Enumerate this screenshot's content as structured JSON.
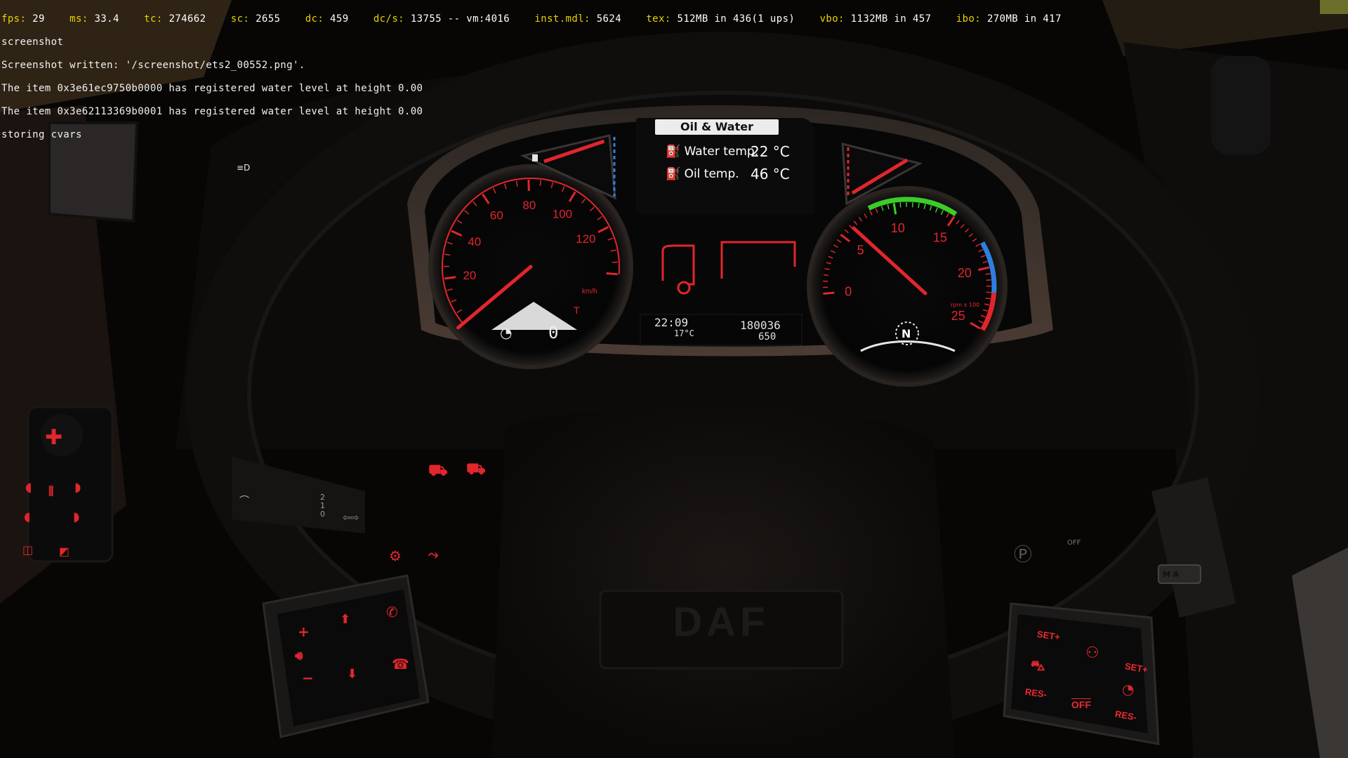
{
  "console": {
    "stats": [
      {
        "label": "fps:",
        "value": "29"
      },
      {
        "label": "ms:",
        "value": "33.4"
      },
      {
        "label": "tc:",
        "value": "274662"
      },
      {
        "label": "sc:",
        "value": "2655"
      },
      {
        "label": "dc:",
        "value": "459"
      },
      {
        "label": "dc/s:",
        "value": "13755 -- vm:4016"
      },
      {
        "label": "inst.mdl:",
        "value": "5624"
      },
      {
        "label": "tex:",
        "value": "512MB in 436(1 ups)"
      },
      {
        "label": "vbo:",
        "value": "1132MB in 457"
      },
      {
        "label": "ibo:",
        "value": "270MB in 417"
      }
    ],
    "lines": [
      "screenshot",
      "Screenshot written: '/screenshot/ets2_00552.png'.",
      "The item 0x3e61ec9750b0000 has registered water level at height 0.00",
      "The item 0x3e62113369b0001 has registered water level at height 0.00",
      "storing cvars"
    ]
  },
  "dashboard": {
    "lcd": {
      "tab_title": "Oil & Water",
      "water_label": "Water temp.",
      "water_value": "22 °C",
      "oil_label": "Oil temp.",
      "oil_value": "46 °C",
      "time": "22:09",
      "outside_temp": "17°C",
      "odometer": "180036",
      "trip": "650"
    },
    "speedometer": {
      "ticks": [
        "20",
        "40",
        "60",
        "80",
        "100",
        "120"
      ],
      "unit": "km/h",
      "speed_value": 0,
      "gear_readout": "0",
      "retarder_letter": "T"
    },
    "tachometer": {
      "ticks": [
        "0",
        "5",
        "10",
        "15",
        "20",
        "25"
      ],
      "unit": "rpm x 100",
      "rpm_value": 550,
      "gear": "N"
    },
    "gauges": {
      "fuel_level": 0.5,
      "adblue_level": 0.55
    },
    "wheel": {
      "brand": "DAF",
      "left_pad": [
        "+",
        "−",
        "⬆",
        "⬇"
      ],
      "right_pad": [
        "SET+",
        "SET+",
        "RES-",
        "RES-",
        "OFF"
      ]
    },
    "stalk": {
      "numbers": [
        "2",
        "1",
        "0"
      ],
      "off_label": "OFF",
      "p_label": "P",
      "mode_label": "M A"
    }
  },
  "colors": {
    "accent_red": "#e1262c",
    "eco_green": "#3ccc2a",
    "blue_band": "#2f7fe0",
    "lcd_tab": "#ececec",
    "console_label": "#e6d400"
  }
}
